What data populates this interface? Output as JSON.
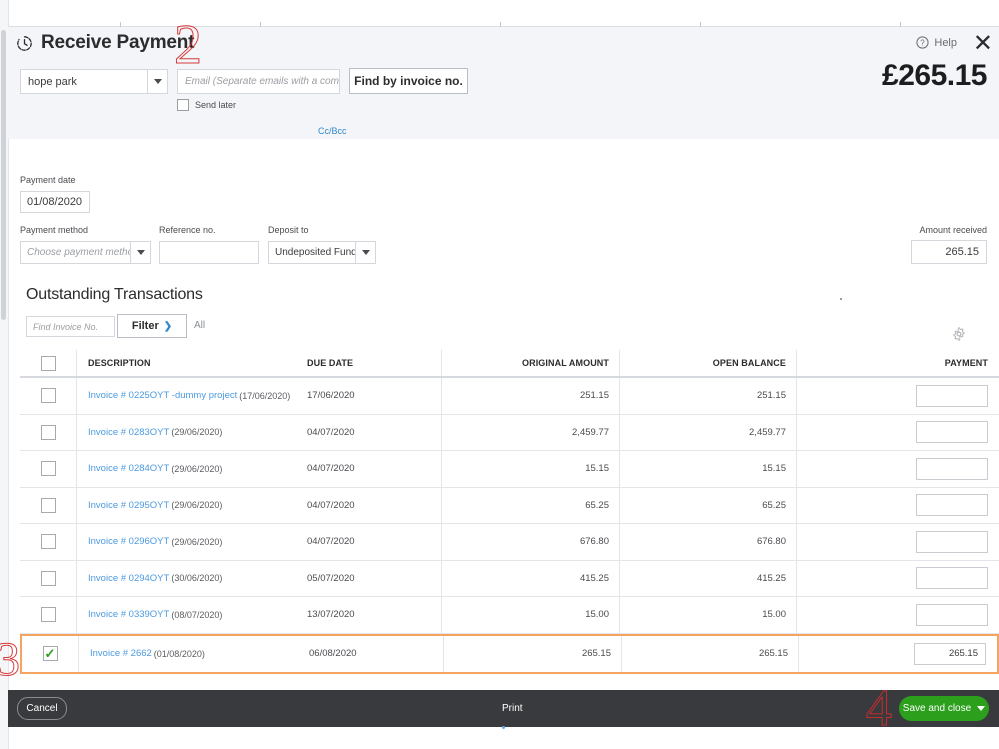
{
  "window": {
    "title": "Receive Payment",
    "help_label": "Help",
    "close_icon": "close-icon",
    "grand_total": "£265.15",
    "history_icon": "history-clock-icon"
  },
  "header": {
    "customer": {
      "value": "hope park"
    },
    "email": {
      "placeholder": "Email (Separate emails with a comma)",
      "value": ""
    },
    "find_by_invoice_label": "Find by invoice no.",
    "send_later_label": "Send later",
    "send_later_checked": false,
    "ccbcc_label": "Cc/Bcc"
  },
  "form": {
    "payment_date_label": "Payment date",
    "payment_date_value": "01/08/2020",
    "payment_method_label": "Payment method",
    "payment_method_placeholder": "Choose payment method",
    "reference_label": "Reference no.",
    "reference_value": "",
    "deposit_to_label": "Deposit to",
    "deposit_to_value": "Undeposited Funds",
    "amount_received_label": "Amount received",
    "amount_received_value": "265.15"
  },
  "transactions": {
    "section_title": "Outstanding Transactions",
    "find_invoice_placeholder": "Find Invoice No.",
    "filter_label": "Filter",
    "filter_chevron": "chevron-right-icon",
    "all_label": "All",
    "settings_icon": "gear-icon",
    "columns": [
      "DESCRIPTION",
      "DUE DATE",
      "ORIGINAL AMOUNT",
      "OPEN BALANCE",
      "PAYMENT"
    ],
    "rows": [
      {
        "checked": false,
        "invoice_link": "Invoice # 0225OYT -dummy project",
        "invoice_date": "(17/06/2020)",
        "due_date": "17/06/2020",
        "original_amount": "251.15",
        "open_balance": "251.15",
        "payment": ""
      },
      {
        "checked": false,
        "invoice_link": "Invoice # 0283OYT",
        "invoice_date": "(29/06/2020)",
        "due_date": "04/07/2020",
        "original_amount": "2,459.77",
        "open_balance": "2,459.77",
        "payment": ""
      },
      {
        "checked": false,
        "invoice_link": "Invoice # 0284OYT",
        "invoice_date": "(29/06/2020)",
        "due_date": "04/07/2020",
        "original_amount": "15.15",
        "open_balance": "15.15",
        "payment": ""
      },
      {
        "checked": false,
        "invoice_link": "Invoice # 0295OYT",
        "invoice_date": "(29/06/2020)",
        "due_date": "04/07/2020",
        "original_amount": "65.25",
        "open_balance": "65.25",
        "payment": ""
      },
      {
        "checked": false,
        "invoice_link": "Invoice # 0296OYT",
        "invoice_date": "(29/06/2020)",
        "due_date": "04/07/2020",
        "original_amount": "676.80",
        "open_balance": "676.80",
        "payment": ""
      },
      {
        "checked": false,
        "invoice_link": "Invoice # 0294OYT",
        "invoice_date": "(30/06/2020)",
        "due_date": "05/07/2020",
        "original_amount": "415.25",
        "open_balance": "415.25",
        "payment": ""
      },
      {
        "checked": false,
        "invoice_link": "Invoice # 0339OYT",
        "invoice_date": "(08/07/2020)",
        "due_date": "13/07/2020",
        "original_amount": "15.00",
        "open_balance": "15.00",
        "payment": ""
      },
      {
        "checked": true,
        "invoice_link": "Invoice # 2662",
        "invoice_date": "(01/08/2020)",
        "due_date": "06/08/2020",
        "original_amount": "265.15",
        "open_balance": "265.15",
        "payment": "265.15"
      }
    ]
  },
  "footer": {
    "cancel_label": "Cancel",
    "print_label": "Print",
    "save_and_close_label": "Save and close"
  },
  "annotations": [
    {
      "label": "2"
    },
    {
      "label": "3"
    },
    {
      "label": "4"
    }
  ],
  "colors": {
    "accent_green": "#2ca01c",
    "link_blue": "#4c9ae0",
    "footer_dark": "#393a3d",
    "highlight_orange": "#f4a460",
    "annotation_red": "#d32c2c"
  }
}
